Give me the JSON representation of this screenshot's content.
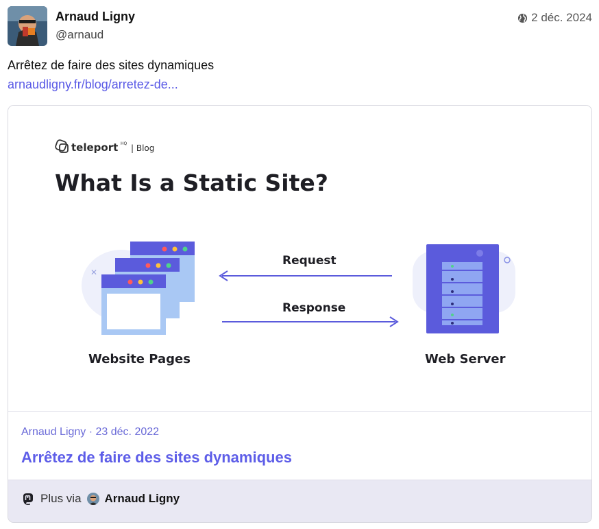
{
  "post": {
    "author_name": "Arnaud Ligny",
    "author_handle": "@arnaud",
    "date": "2 déc. 2024",
    "text": "Arrêtez de faire des sites dynamiques",
    "link_text": "arnaudligny.fr/blog/arretez-de..."
  },
  "card": {
    "image": {
      "brand": "teleport",
      "brand_sup": "HQ",
      "brand_section": "| Blog",
      "headline": "What Is a Static Site?",
      "request_label": "Request",
      "response_label": "Response",
      "left_label": "Website Pages",
      "right_label": "Web Server"
    },
    "meta": "Arnaud Ligny · 23 déc. 2022",
    "title": "Arrêtez de faire des sites dynamiques",
    "footer": {
      "via_label": "Plus via",
      "author": "Arnaud Ligny"
    }
  },
  "colors": {
    "link": "#5a5ae6",
    "accent": "#5d5de8",
    "footer_bg": "#e9e8f3",
    "server": "#5b5bdc"
  },
  "icons": [
    "avatar",
    "globe-icon",
    "teleport-logo-icon",
    "mastodon-icon"
  ]
}
